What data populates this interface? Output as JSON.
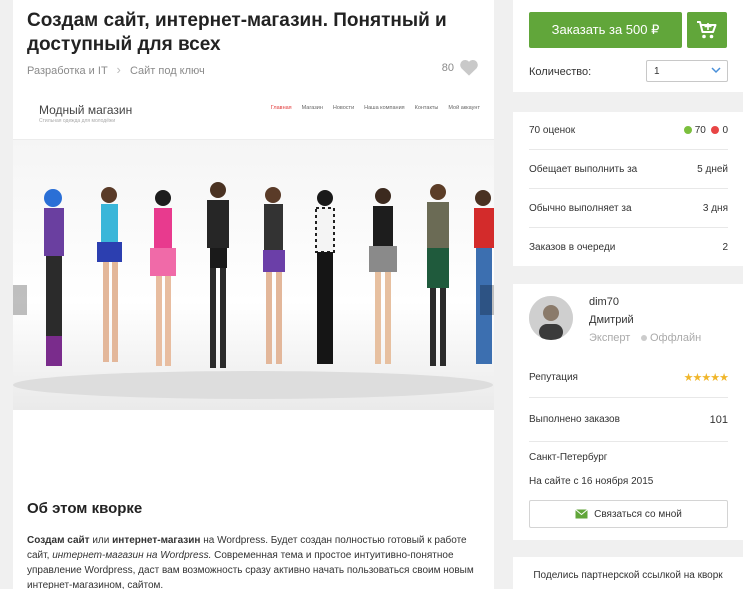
{
  "gig": {
    "title": "Создам сайт, интернет-магазин. Понятный и доступный для всех",
    "breadcrumbs": [
      "Разработка и IT",
      "Сайт под ключ"
    ],
    "likes": "80",
    "about_heading": "Об этом кворке",
    "description": {
      "b1": "Создам сайт",
      "t1": " или ",
      "b2": "интернет-магазин",
      "t2": " на Wordpress. Будет создан полностью готовый к работе сайт, ",
      "i1": "интернет-магазин на Wordpress.",
      "t3": " Современная тема и простое интуитивно-понятное управление Wordpress, даст вам возможность сразу активно начать пользоваться своим новым интернет-магазином, сайтом."
    }
  },
  "preview": {
    "site_name": "Модный магазин",
    "site_tagline": "Стильная одежда для молодёжи",
    "nav": [
      "Главная",
      "Магазин",
      "Новости",
      "Наша компания",
      "Контакты",
      "Мой аккаунт"
    ]
  },
  "order": {
    "button_label": "Заказать за 500 ₽",
    "quantity_label": "Количество:",
    "quantity_value": "1"
  },
  "stats": {
    "ratings_label": "70 оценок",
    "positive": "70",
    "negative": "0",
    "promise_label": "Обещает выполнить за",
    "promise_value": "5 дней",
    "usual_label": "Обычно выполняет за",
    "usual_value": "3 дня",
    "queue_label": "Заказов в очереди",
    "queue_value": "2"
  },
  "seller": {
    "username": "dim70",
    "real_name": "Дмитрий",
    "level": "Эксперт",
    "status": "Оффлайн",
    "reputation_label": "Репутация",
    "rating_stars": 5,
    "orders_label": "Выполнено заказов",
    "orders_value": "101",
    "city": "Санкт-Петербург",
    "since": "На сайте с 16 ноября 2015",
    "contact_label": "Связаться со мной"
  },
  "share": {
    "text": "Поделись партнерской ссылкой на кворк"
  },
  "colors": {
    "accent_green": "#61a63a",
    "positive": "#7bbf3d",
    "negative": "#e84545",
    "star": "#f0b62b"
  },
  "icons": [
    "heart-icon",
    "cart-icon",
    "chevron-down-icon",
    "envelope-icon",
    "chevron-right-icon"
  ]
}
